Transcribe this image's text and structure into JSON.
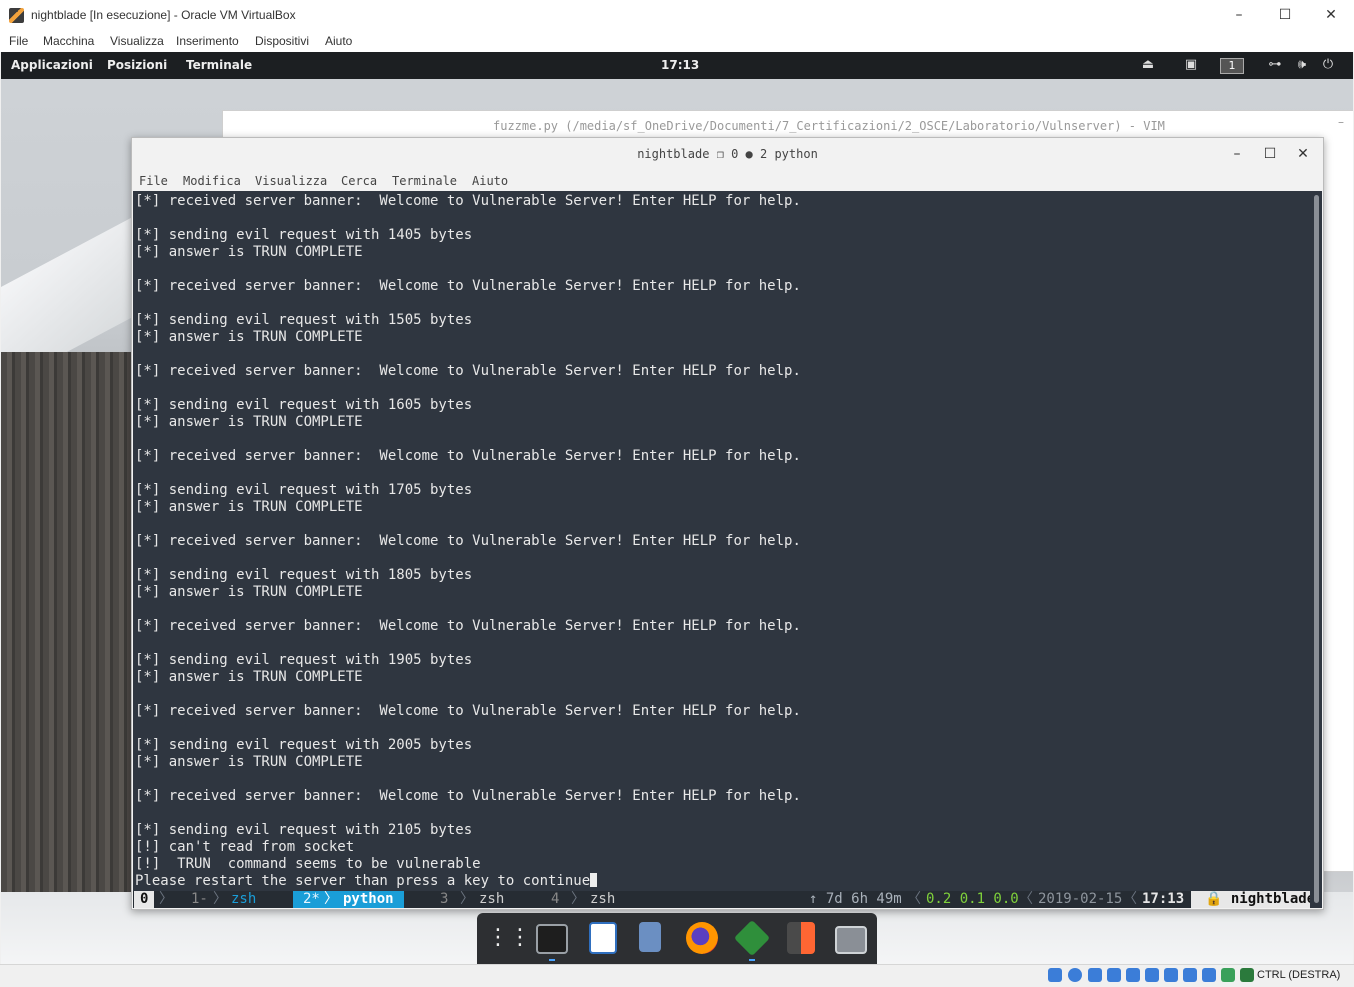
{
  "vb_window": {
    "title": "nightblade [In esecuzione] - Oracle VM VirtualBox",
    "min": "–",
    "max": "☐",
    "close": "✕",
    "menu": [
      "File",
      "Macchina",
      "Visualizza",
      "Inserimento",
      "Dispositivi",
      "Aiuto"
    ]
  },
  "gnome_panel": {
    "applications": "Applicazioni",
    "places": "Posizioni",
    "active_app": "Terminale",
    "clock": "17:13",
    "workspace": "1",
    "tray_icons": [
      "eject-icon",
      "camera-icon",
      "workspace-indicator",
      "network-icon",
      "volume-icon",
      "power-icon"
    ],
    "tray_glyphs": [
      "⏏",
      "▣",
      "",
      "⊶",
      "🕪",
      "⏻"
    ]
  },
  "vim_window": {
    "title": "fuzzme.py (/media/sf_OneDrive/Documenti/7_Certificazioni/2_OSCE/Laboratorio/Vulnserver) - VIM",
    "min": "–"
  },
  "terminal_window": {
    "title": "nightblade ❐ 0 ● 2 python",
    "min": "–",
    "max": "☐",
    "close": "✕",
    "menu": [
      "File",
      "Modifica",
      "Visualizza",
      "Cerca",
      "Terminale",
      "Aiuto"
    ],
    "lines": [
      "[*] received server banner:  Welcome to Vulnerable Server! Enter HELP for help.",
      "",
      "[*] sending evil request with 1405 bytes",
      "[*] answer is TRUN COMPLETE",
      "",
      "[*] received server banner:  Welcome to Vulnerable Server! Enter HELP for help.",
      "",
      "[*] sending evil request with 1505 bytes",
      "[*] answer is TRUN COMPLETE",
      "",
      "[*] received server banner:  Welcome to Vulnerable Server! Enter HELP for help.",
      "",
      "[*] sending evil request with 1605 bytes",
      "[*] answer is TRUN COMPLETE",
      "",
      "[*] received server banner:  Welcome to Vulnerable Server! Enter HELP for help.",
      "",
      "[*] sending evil request with 1705 bytes",
      "[*] answer is TRUN COMPLETE",
      "",
      "[*] received server banner:  Welcome to Vulnerable Server! Enter HELP for help.",
      "",
      "[*] sending evil request with 1805 bytes",
      "[*] answer is TRUN COMPLETE",
      "",
      "[*] received server banner:  Welcome to Vulnerable Server! Enter HELP for help.",
      "",
      "[*] sending evil request with 1905 bytes",
      "[*] answer is TRUN COMPLETE",
      "",
      "[*] received server banner:  Welcome to Vulnerable Server! Enter HELP for help.",
      "",
      "[*] sending evil request with 2005 bytes",
      "[*] answer is TRUN COMPLETE",
      "",
      "[*] received server banner:  Welcome to Vulnerable Server! Enter HELP for help.",
      "",
      "[*] sending evil request with 2105 bytes",
      "[!] can't read from socket",
      "[!]  TRUN  command seems to be vulnerable",
      "Please restart the server than press a key to continue"
    ]
  },
  "tmux": {
    "session": "0",
    "win1_index": "1-",
    "win1_name": "zsh",
    "win2_index": "2*",
    "win2_name": "python",
    "win3_index": "3",
    "win3_name": "zsh",
    "win4_index": "4",
    "win4_name": "zsh",
    "uptime": "↑ 7d 6h 49m",
    "load": "0.2 0.1 0.0",
    "date": "2019-02-15",
    "time": "17:13",
    "host": "🔒 nightblade",
    "colors": {
      "active": "#1a9ed8",
      "load": "#7fd13b",
      "window_name": "#1a9ed8"
    }
  },
  "dock": {
    "items": [
      "app-grid-icon",
      "terminal-icon",
      "text-editor-icon",
      "file-manager-icon",
      "firefox-icon",
      "vim-icon",
      "burp-suite-icon",
      "screenshot-icon"
    ]
  },
  "vb_status": {
    "host_key": "CTRL (DESTRA)",
    "icons": [
      "hard-disk-icon",
      "optical-drive-icon",
      "audio-icon",
      "network-icon",
      "usb-icon",
      "shared-folders-icon",
      "display-icon",
      "video-capture-icon",
      "recording-icon",
      "cpu-icon",
      "mouse-integration-icon",
      "keyboard-icon"
    ]
  }
}
